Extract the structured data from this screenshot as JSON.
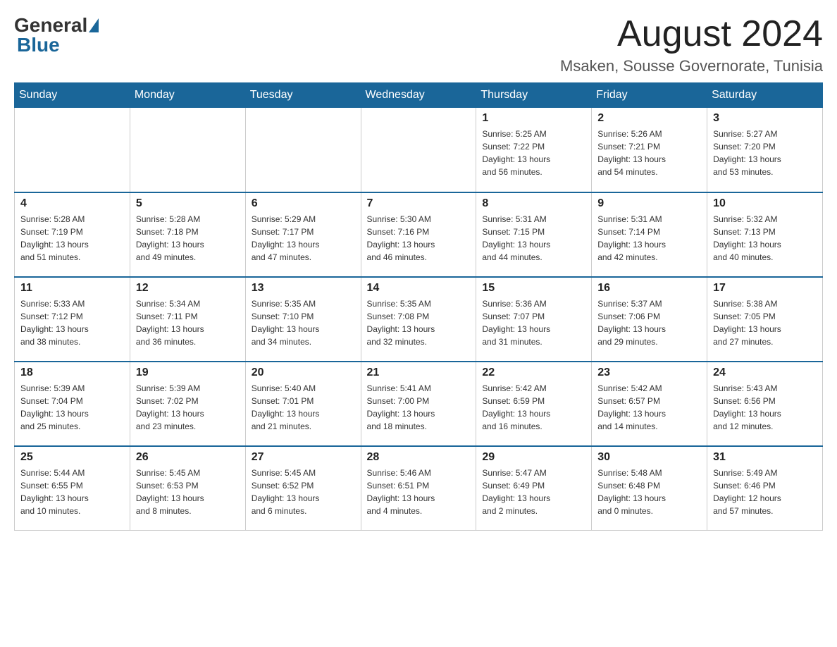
{
  "logo": {
    "general": "General",
    "blue": "Blue"
  },
  "title": {
    "month_year": "August 2024",
    "location": "Msaken, Sousse Governorate, Tunisia"
  },
  "headers": [
    "Sunday",
    "Monday",
    "Tuesday",
    "Wednesday",
    "Thursday",
    "Friday",
    "Saturday"
  ],
  "weeks": [
    [
      {
        "day": "",
        "info": ""
      },
      {
        "day": "",
        "info": ""
      },
      {
        "day": "",
        "info": ""
      },
      {
        "day": "",
        "info": ""
      },
      {
        "day": "1",
        "info": "Sunrise: 5:25 AM\nSunset: 7:22 PM\nDaylight: 13 hours\nand 56 minutes."
      },
      {
        "day": "2",
        "info": "Sunrise: 5:26 AM\nSunset: 7:21 PM\nDaylight: 13 hours\nand 54 minutes."
      },
      {
        "day": "3",
        "info": "Sunrise: 5:27 AM\nSunset: 7:20 PM\nDaylight: 13 hours\nand 53 minutes."
      }
    ],
    [
      {
        "day": "4",
        "info": "Sunrise: 5:28 AM\nSunset: 7:19 PM\nDaylight: 13 hours\nand 51 minutes."
      },
      {
        "day": "5",
        "info": "Sunrise: 5:28 AM\nSunset: 7:18 PM\nDaylight: 13 hours\nand 49 minutes."
      },
      {
        "day": "6",
        "info": "Sunrise: 5:29 AM\nSunset: 7:17 PM\nDaylight: 13 hours\nand 47 minutes."
      },
      {
        "day": "7",
        "info": "Sunrise: 5:30 AM\nSunset: 7:16 PM\nDaylight: 13 hours\nand 46 minutes."
      },
      {
        "day": "8",
        "info": "Sunrise: 5:31 AM\nSunset: 7:15 PM\nDaylight: 13 hours\nand 44 minutes."
      },
      {
        "day": "9",
        "info": "Sunrise: 5:31 AM\nSunset: 7:14 PM\nDaylight: 13 hours\nand 42 minutes."
      },
      {
        "day": "10",
        "info": "Sunrise: 5:32 AM\nSunset: 7:13 PM\nDaylight: 13 hours\nand 40 minutes."
      }
    ],
    [
      {
        "day": "11",
        "info": "Sunrise: 5:33 AM\nSunset: 7:12 PM\nDaylight: 13 hours\nand 38 minutes."
      },
      {
        "day": "12",
        "info": "Sunrise: 5:34 AM\nSunset: 7:11 PM\nDaylight: 13 hours\nand 36 minutes."
      },
      {
        "day": "13",
        "info": "Sunrise: 5:35 AM\nSunset: 7:10 PM\nDaylight: 13 hours\nand 34 minutes."
      },
      {
        "day": "14",
        "info": "Sunrise: 5:35 AM\nSunset: 7:08 PM\nDaylight: 13 hours\nand 32 minutes."
      },
      {
        "day": "15",
        "info": "Sunrise: 5:36 AM\nSunset: 7:07 PM\nDaylight: 13 hours\nand 31 minutes."
      },
      {
        "day": "16",
        "info": "Sunrise: 5:37 AM\nSunset: 7:06 PM\nDaylight: 13 hours\nand 29 minutes."
      },
      {
        "day": "17",
        "info": "Sunrise: 5:38 AM\nSunset: 7:05 PM\nDaylight: 13 hours\nand 27 minutes."
      }
    ],
    [
      {
        "day": "18",
        "info": "Sunrise: 5:39 AM\nSunset: 7:04 PM\nDaylight: 13 hours\nand 25 minutes."
      },
      {
        "day": "19",
        "info": "Sunrise: 5:39 AM\nSunset: 7:02 PM\nDaylight: 13 hours\nand 23 minutes."
      },
      {
        "day": "20",
        "info": "Sunrise: 5:40 AM\nSunset: 7:01 PM\nDaylight: 13 hours\nand 21 minutes."
      },
      {
        "day": "21",
        "info": "Sunrise: 5:41 AM\nSunset: 7:00 PM\nDaylight: 13 hours\nand 18 minutes."
      },
      {
        "day": "22",
        "info": "Sunrise: 5:42 AM\nSunset: 6:59 PM\nDaylight: 13 hours\nand 16 minutes."
      },
      {
        "day": "23",
        "info": "Sunrise: 5:42 AM\nSunset: 6:57 PM\nDaylight: 13 hours\nand 14 minutes."
      },
      {
        "day": "24",
        "info": "Sunrise: 5:43 AM\nSunset: 6:56 PM\nDaylight: 13 hours\nand 12 minutes."
      }
    ],
    [
      {
        "day": "25",
        "info": "Sunrise: 5:44 AM\nSunset: 6:55 PM\nDaylight: 13 hours\nand 10 minutes."
      },
      {
        "day": "26",
        "info": "Sunrise: 5:45 AM\nSunset: 6:53 PM\nDaylight: 13 hours\nand 8 minutes."
      },
      {
        "day": "27",
        "info": "Sunrise: 5:45 AM\nSunset: 6:52 PM\nDaylight: 13 hours\nand 6 minutes."
      },
      {
        "day": "28",
        "info": "Sunrise: 5:46 AM\nSunset: 6:51 PM\nDaylight: 13 hours\nand 4 minutes."
      },
      {
        "day": "29",
        "info": "Sunrise: 5:47 AM\nSunset: 6:49 PM\nDaylight: 13 hours\nand 2 minutes."
      },
      {
        "day": "30",
        "info": "Sunrise: 5:48 AM\nSunset: 6:48 PM\nDaylight: 13 hours\nand 0 minutes."
      },
      {
        "day": "31",
        "info": "Sunrise: 5:49 AM\nSunset: 6:46 PM\nDaylight: 12 hours\nand 57 minutes."
      }
    ]
  ]
}
